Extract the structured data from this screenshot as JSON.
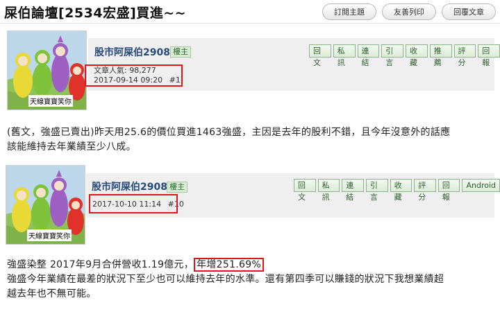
{
  "header": {
    "title": "屎伯論壇[2534宏盛]買進~~",
    "buttons": [
      "訂閱主題",
      "友善列印",
      "回覆文章"
    ]
  },
  "posts": [
    {
      "avatar_caption": "天線寶寶笑你",
      "author": "股市阿屎伯2908",
      "badge": "樓主",
      "actions": [
        "回文",
        "私訊",
        "連結",
        "引言",
        "收藏",
        "推薦",
        "評分",
        "回報"
      ],
      "views": "文章人氣: 98,277",
      "timestamp": "2017-09-14 09:20",
      "floor": "#1",
      "content": [
        "(舊文，強盛已賣出)昨天用25.6的價位買進1463強盛，主因是去年的股利不錯，且今年沒意外的話應",
        "該能維持去年業績至少八成。"
      ]
    },
    {
      "avatar_caption": "天線寶寶笑你",
      "author": "股市阿屎伯2908",
      "badge": "樓主",
      "actions": [
        "回文",
        "私訊",
        "連結",
        "引言",
        "收藏",
        "評分",
        "回報",
        "Android"
      ],
      "timestamp": "2017-10-10 11:14",
      "floor": "#10",
      "content_line1_pre": "強盛染整 2017年9月合併營收1.19億元，",
      "content_line1_highlight": "年增251.69%",
      "content_rest": [
        "強盛今年業績在最差的狀況下至少也可以維持去年的水準。還有第四季可以賺錢的狀況下我想業績超",
        "越去年也不無可能。"
      ]
    }
  ],
  "colors": {
    "highlight_box": "#e0141d",
    "author": "#274a7a",
    "action_green": "#2f5d2f"
  }
}
